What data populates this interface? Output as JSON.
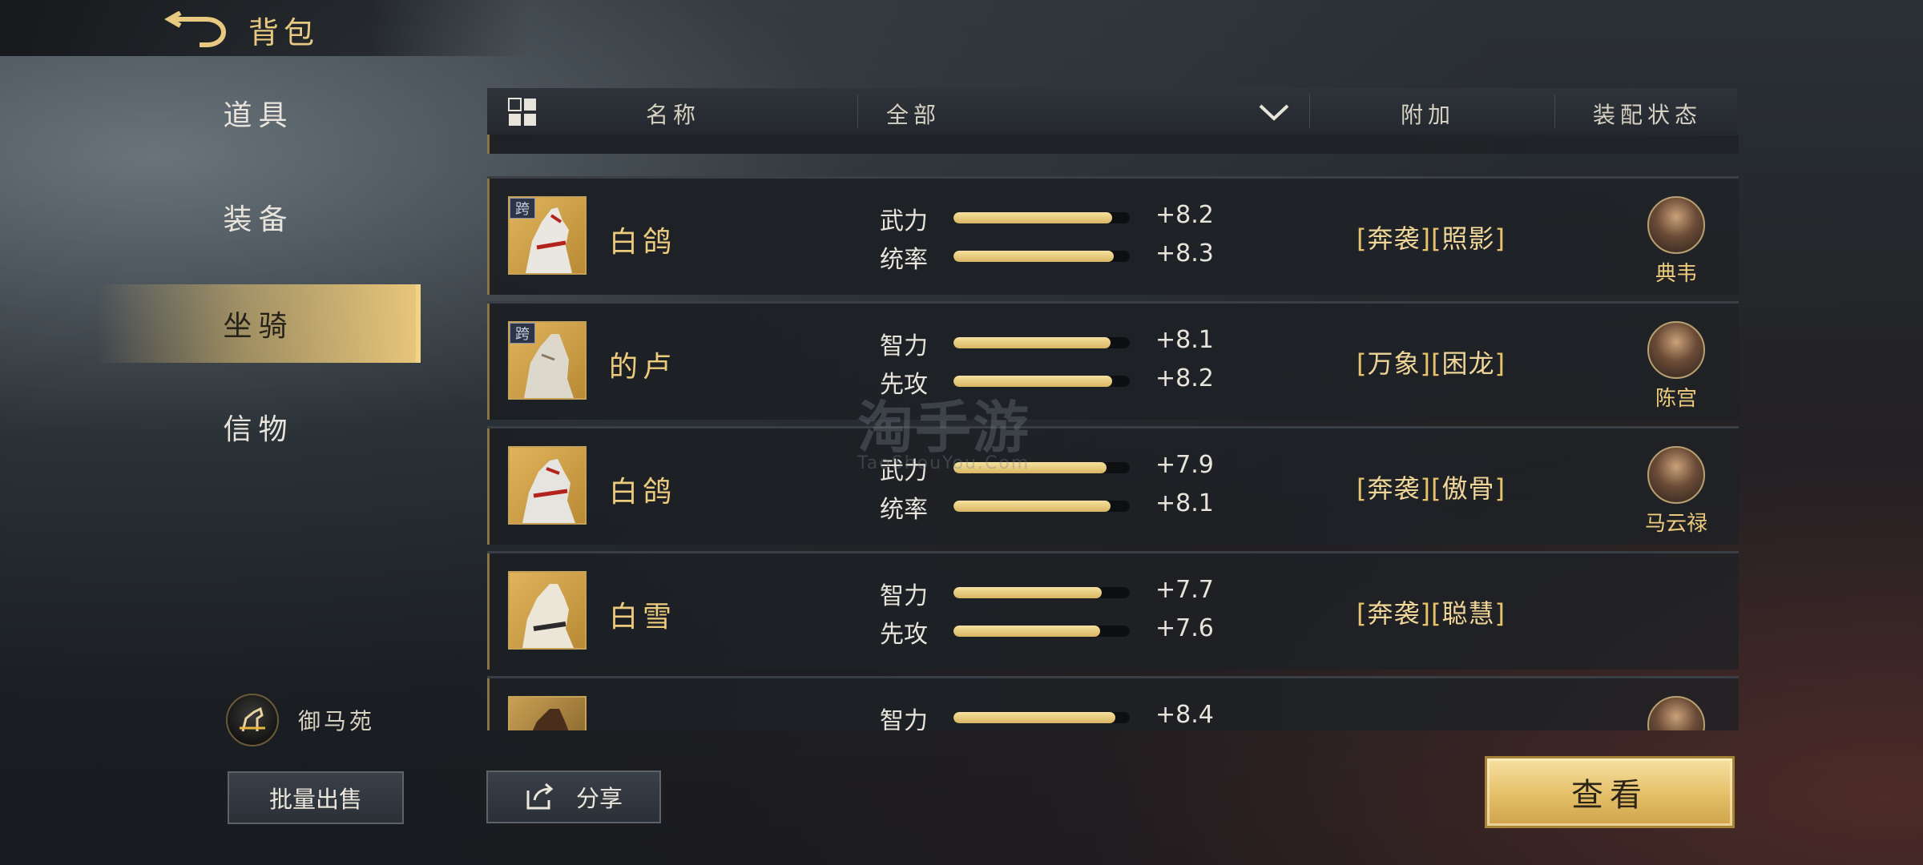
{
  "header": {
    "title": "背包"
  },
  "nav": {
    "items": [
      {
        "label": "道具"
      },
      {
        "label": "装备"
      },
      {
        "label": "坐骑"
      },
      {
        "label": "信物"
      }
    ]
  },
  "stable": {
    "label": "御马苑"
  },
  "buttons": {
    "bulk_sell": "批量出售",
    "share": "分享",
    "view": "查看"
  },
  "table": {
    "col_name": "名称",
    "filter_value": "全部",
    "col_extra": "附加",
    "col_equip": "装配状态"
  },
  "rows": [
    {
      "tag": "跨",
      "name": "白鸽",
      "stat1": {
        "label": "武力",
        "value": "+8.2",
        "fill": 0.9
      },
      "stat2": {
        "label": "统率",
        "value": "+8.3",
        "fill": 0.91
      },
      "extra1": "奔袭",
      "extra2": "照影",
      "hero": "典韦"
    },
    {
      "tag": "跨",
      "name": "的卢",
      "stat1": {
        "label": "智力",
        "value": "+8.1",
        "fill": 0.89
      },
      "stat2": {
        "label": "先攻",
        "value": "+8.2",
        "fill": 0.9
      },
      "extra1": "万象",
      "extra2": "困龙",
      "hero": "陈宫"
    },
    {
      "tag": "",
      "name": "白鸽",
      "stat1": {
        "label": "武力",
        "value": "+7.9",
        "fill": 0.87
      },
      "stat2": {
        "label": "统率",
        "value": "+8.1",
        "fill": 0.89
      },
      "extra1": "奔袭",
      "extra2": "傲骨",
      "hero": "马云禄"
    },
    {
      "tag": "",
      "name": "白雪",
      "stat1": {
        "label": "智力",
        "value": "+7.7",
        "fill": 0.84
      },
      "stat2": {
        "label": "先攻",
        "value": "+7.6",
        "fill": 0.83
      },
      "extra1": "奔袭",
      "extra2": "聪慧",
      "hero": ""
    },
    {
      "tag": "",
      "name": "",
      "stat1": {
        "label": "智力",
        "value": "+8.4",
        "fill": 0.92
      },
      "stat2": {
        "label": "",
        "value": "",
        "fill": 0
      },
      "extra1": "",
      "extra2": "",
      "hero": ""
    }
  ],
  "watermark": {
    "text": "淘手游",
    "sub": "TaoShouYou.Com"
  },
  "colors": {
    "gold": "#e9c77a",
    "accent_text": "#eccb7d",
    "bar_fill": "#d9b563"
  }
}
